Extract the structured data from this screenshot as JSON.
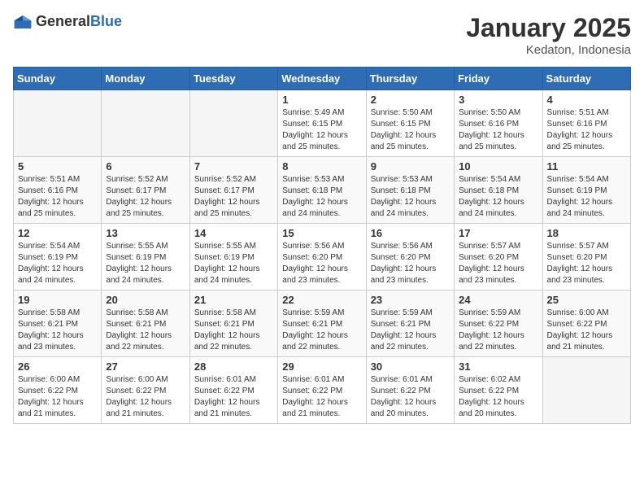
{
  "header": {
    "logo_general": "General",
    "logo_blue": "Blue",
    "month_year": "January 2025",
    "location": "Kedaton, Indonesia"
  },
  "days_of_week": [
    "Sunday",
    "Monday",
    "Tuesday",
    "Wednesday",
    "Thursday",
    "Friday",
    "Saturday"
  ],
  "weeks": [
    [
      {
        "day": "",
        "info": ""
      },
      {
        "day": "",
        "info": ""
      },
      {
        "day": "",
        "info": ""
      },
      {
        "day": "1",
        "info": "Sunrise: 5:49 AM\nSunset: 6:15 PM\nDaylight: 12 hours\nand 25 minutes."
      },
      {
        "day": "2",
        "info": "Sunrise: 5:50 AM\nSunset: 6:15 PM\nDaylight: 12 hours\nand 25 minutes."
      },
      {
        "day": "3",
        "info": "Sunrise: 5:50 AM\nSunset: 6:16 PM\nDaylight: 12 hours\nand 25 minutes."
      },
      {
        "day": "4",
        "info": "Sunrise: 5:51 AM\nSunset: 6:16 PM\nDaylight: 12 hours\nand 25 minutes."
      }
    ],
    [
      {
        "day": "5",
        "info": "Sunrise: 5:51 AM\nSunset: 6:16 PM\nDaylight: 12 hours\nand 25 minutes."
      },
      {
        "day": "6",
        "info": "Sunrise: 5:52 AM\nSunset: 6:17 PM\nDaylight: 12 hours\nand 25 minutes."
      },
      {
        "day": "7",
        "info": "Sunrise: 5:52 AM\nSunset: 6:17 PM\nDaylight: 12 hours\nand 25 minutes."
      },
      {
        "day": "8",
        "info": "Sunrise: 5:53 AM\nSunset: 6:18 PM\nDaylight: 12 hours\nand 24 minutes."
      },
      {
        "day": "9",
        "info": "Sunrise: 5:53 AM\nSunset: 6:18 PM\nDaylight: 12 hours\nand 24 minutes."
      },
      {
        "day": "10",
        "info": "Sunrise: 5:54 AM\nSunset: 6:18 PM\nDaylight: 12 hours\nand 24 minutes."
      },
      {
        "day": "11",
        "info": "Sunrise: 5:54 AM\nSunset: 6:19 PM\nDaylight: 12 hours\nand 24 minutes."
      }
    ],
    [
      {
        "day": "12",
        "info": "Sunrise: 5:54 AM\nSunset: 6:19 PM\nDaylight: 12 hours\nand 24 minutes."
      },
      {
        "day": "13",
        "info": "Sunrise: 5:55 AM\nSunset: 6:19 PM\nDaylight: 12 hours\nand 24 minutes."
      },
      {
        "day": "14",
        "info": "Sunrise: 5:55 AM\nSunset: 6:19 PM\nDaylight: 12 hours\nand 24 minutes."
      },
      {
        "day": "15",
        "info": "Sunrise: 5:56 AM\nSunset: 6:20 PM\nDaylight: 12 hours\nand 23 minutes."
      },
      {
        "day": "16",
        "info": "Sunrise: 5:56 AM\nSunset: 6:20 PM\nDaylight: 12 hours\nand 23 minutes."
      },
      {
        "day": "17",
        "info": "Sunrise: 5:57 AM\nSunset: 6:20 PM\nDaylight: 12 hours\nand 23 minutes."
      },
      {
        "day": "18",
        "info": "Sunrise: 5:57 AM\nSunset: 6:20 PM\nDaylight: 12 hours\nand 23 minutes."
      }
    ],
    [
      {
        "day": "19",
        "info": "Sunrise: 5:58 AM\nSunset: 6:21 PM\nDaylight: 12 hours\nand 23 minutes."
      },
      {
        "day": "20",
        "info": "Sunrise: 5:58 AM\nSunset: 6:21 PM\nDaylight: 12 hours\nand 22 minutes."
      },
      {
        "day": "21",
        "info": "Sunrise: 5:58 AM\nSunset: 6:21 PM\nDaylight: 12 hours\nand 22 minutes."
      },
      {
        "day": "22",
        "info": "Sunrise: 5:59 AM\nSunset: 6:21 PM\nDaylight: 12 hours\nand 22 minutes."
      },
      {
        "day": "23",
        "info": "Sunrise: 5:59 AM\nSunset: 6:21 PM\nDaylight: 12 hours\nand 22 minutes."
      },
      {
        "day": "24",
        "info": "Sunrise: 5:59 AM\nSunset: 6:22 PM\nDaylight: 12 hours\nand 22 minutes."
      },
      {
        "day": "25",
        "info": "Sunrise: 6:00 AM\nSunset: 6:22 PM\nDaylight: 12 hours\nand 21 minutes."
      }
    ],
    [
      {
        "day": "26",
        "info": "Sunrise: 6:00 AM\nSunset: 6:22 PM\nDaylight: 12 hours\nand 21 minutes."
      },
      {
        "day": "27",
        "info": "Sunrise: 6:00 AM\nSunset: 6:22 PM\nDaylight: 12 hours\nand 21 minutes."
      },
      {
        "day": "28",
        "info": "Sunrise: 6:01 AM\nSunset: 6:22 PM\nDaylight: 12 hours\nand 21 minutes."
      },
      {
        "day": "29",
        "info": "Sunrise: 6:01 AM\nSunset: 6:22 PM\nDaylight: 12 hours\nand 21 minutes."
      },
      {
        "day": "30",
        "info": "Sunrise: 6:01 AM\nSunset: 6:22 PM\nDaylight: 12 hours\nand 20 minutes."
      },
      {
        "day": "31",
        "info": "Sunrise: 6:02 AM\nSunset: 6:22 PM\nDaylight: 12 hours\nand 20 minutes."
      },
      {
        "day": "",
        "info": ""
      }
    ]
  ]
}
